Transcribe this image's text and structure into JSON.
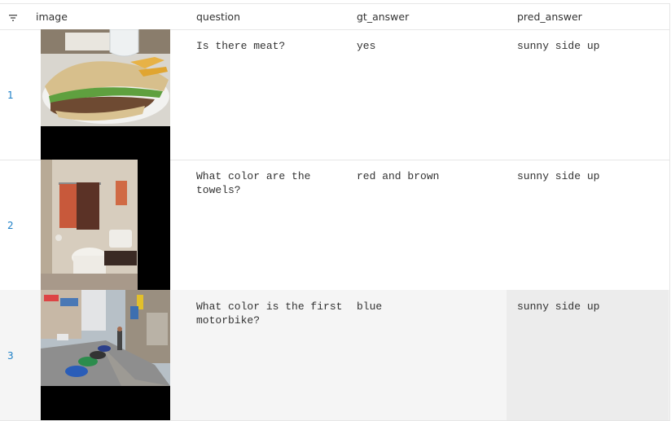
{
  "header": {
    "filter_icon": "filter-icon",
    "columns": [
      "image",
      "question",
      "gt_answer",
      "pred_answer"
    ]
  },
  "rows": [
    {
      "index": "1",
      "image": "sandwich-with-fries",
      "question": "Is there meat?",
      "gt_answer": "yes",
      "pred_answer": "sunny side up"
    },
    {
      "index": "2",
      "image": "bathroom-with-towels",
      "question": "What color are the towels?",
      "gt_answer": "red and brown",
      "pred_answer": "sunny side up"
    },
    {
      "index": "3",
      "image": "street-with-motorbikes",
      "question": "What color is the first motorbike?",
      "gt_answer": "blue",
      "pred_answer": "sunny side up"
    }
  ],
  "colors": {
    "index_link": "#1c7fc7",
    "selected_row": "#f5f5f5",
    "selected_cell": "#ececec"
  }
}
